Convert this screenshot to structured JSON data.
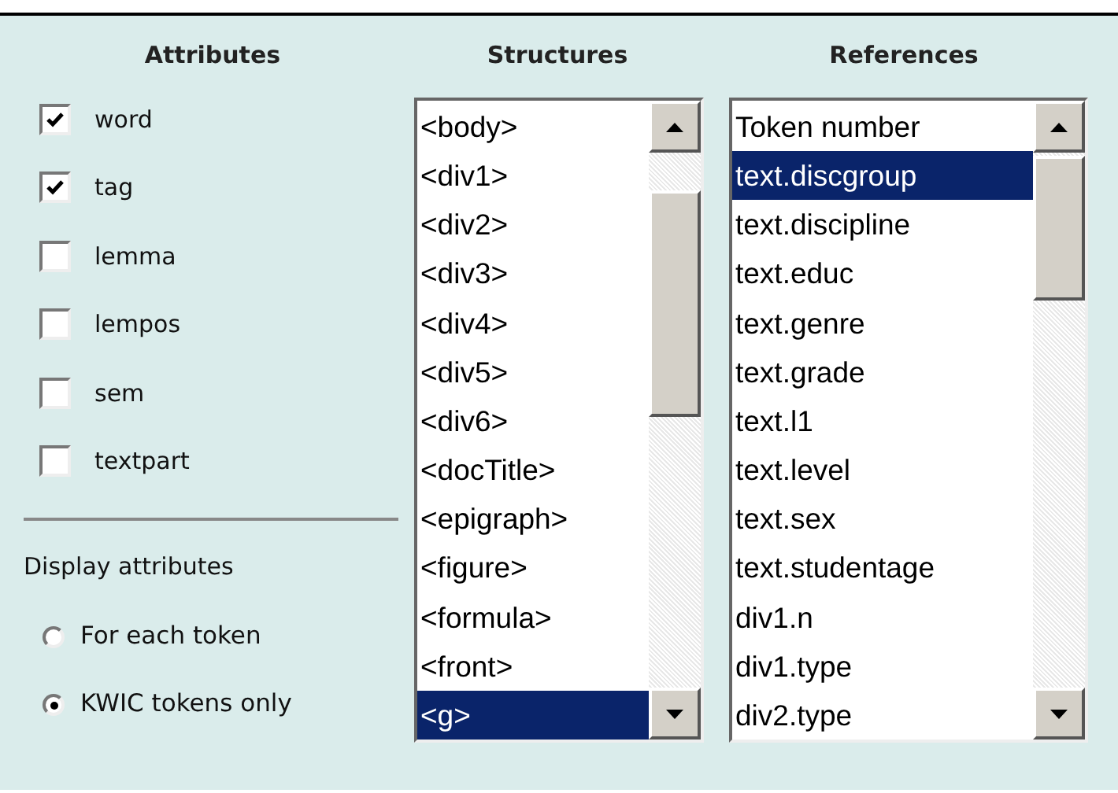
{
  "attributes": {
    "title": "Attributes",
    "items": [
      {
        "label": "word",
        "checked": true
      },
      {
        "label": "tag",
        "checked": true
      },
      {
        "label": "lemma",
        "checked": false
      },
      {
        "label": "lempos",
        "checked": false
      },
      {
        "label": "sem",
        "checked": false
      },
      {
        "label": "textpart",
        "checked": false
      }
    ]
  },
  "display": {
    "title": "Display attributes",
    "options": [
      {
        "label": "For each token",
        "selected": false
      },
      {
        "label": "KWIC tokens only",
        "selected": true
      }
    ]
  },
  "structures": {
    "title": "Structures",
    "items": [
      {
        "label": "<body>",
        "selected": false
      },
      {
        "label": "<div1>",
        "selected": false
      },
      {
        "label": "<div2>",
        "selected": false
      },
      {
        "label": "<div3>",
        "selected": false
      },
      {
        "label": "<div4>",
        "selected": false
      },
      {
        "label": "<div5>",
        "selected": false
      },
      {
        "label": "<div6>",
        "selected": false
      },
      {
        "label": "<docTitle>",
        "selected": false
      },
      {
        "label": "<epigraph>",
        "selected": false
      },
      {
        "label": "<figure>",
        "selected": false
      },
      {
        "label": "<formula>",
        "selected": false
      },
      {
        "label": "<front>",
        "selected": false
      },
      {
        "label": "<g>",
        "selected": true
      }
    ]
  },
  "references": {
    "title": "References",
    "items": [
      {
        "label": "Token number",
        "selected": false
      },
      {
        "label": "text.discgroup",
        "selected": true
      },
      {
        "label": "text.discipline",
        "selected": false
      },
      {
        "label": "text.educ",
        "selected": false
      },
      {
        "label": "text.genre",
        "selected": false
      },
      {
        "label": "text.grade",
        "selected": false
      },
      {
        "label": "text.l1",
        "selected": false
      },
      {
        "label": "text.level",
        "selected": false
      },
      {
        "label": "text.sex",
        "selected": false
      },
      {
        "label": "text.studentage",
        "selected": false
      },
      {
        "label": "div1.n",
        "selected": false
      },
      {
        "label": "div1.type",
        "selected": false
      },
      {
        "label": "div2.type",
        "selected": false
      }
    ]
  }
}
